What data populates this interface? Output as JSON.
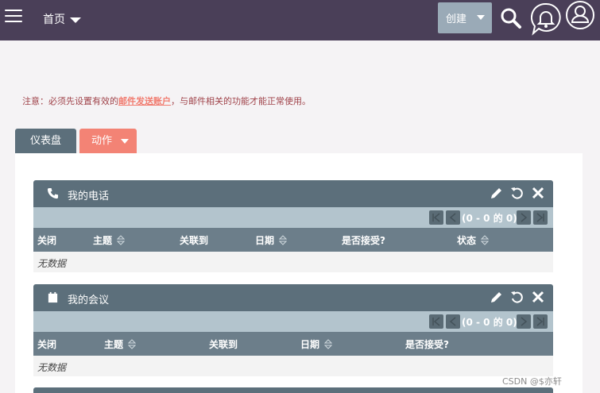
{
  "topbar": {
    "home_label": "首页",
    "create_label": "创建",
    "icons": [
      "menu-icon",
      "search-icon",
      "notification-bell-icon",
      "user-avatar-icon"
    ]
  },
  "notice": {
    "prefix": "注意：必须先设置有效的",
    "link": "邮件发送账户",
    "suffix": "，与邮件相关的功能才能正常使用。"
  },
  "tabs": {
    "dashboard": "仪表盘",
    "actions": "动作"
  },
  "dashlets": [
    {
      "title": "我的电话",
      "icon": "phone-icon",
      "pager": "(0 - 0 的 0)",
      "columns": [
        "关闭",
        "主题",
        "关联到",
        "日期",
        "是否接受?",
        "状态"
      ],
      "empty_text": "无数据"
    },
    {
      "title": "我的会议",
      "icon": "calendar-icon",
      "pager": "(0 - 0 的 0)",
      "columns": [
        "关闭",
        "主题",
        "关联到",
        "日期",
        "是否接受?"
      ],
      "empty_text": "无数据"
    }
  ],
  "watermark": "CSDN @$亦轩",
  "colors": {
    "topbar": "#4a3f58",
    "dashlet_header": "#5c6f7b",
    "pager_bar": "#b3c4cd",
    "accent": "#f38375"
  }
}
